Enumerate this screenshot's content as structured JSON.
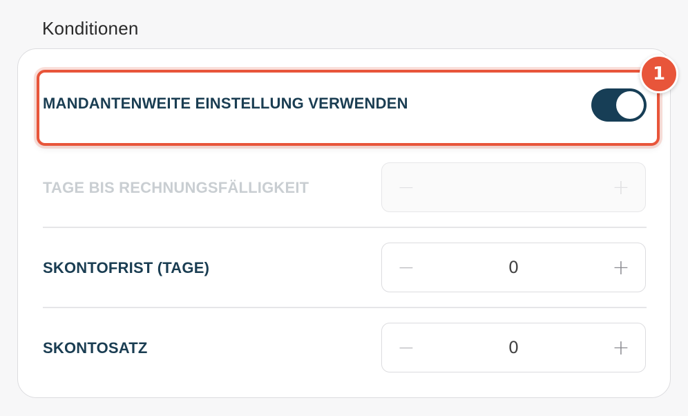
{
  "section": {
    "title": "Konditionen"
  },
  "badge": {
    "number": "1",
    "color": "#e8553a"
  },
  "toggle_row": {
    "label": "MANDANTENWEITE EINSTELLUNG VERWENDEN",
    "checked": true,
    "color": "#173e56"
  },
  "rows": [
    {
      "label": "TAGE BIS RECHNUNGSFÄLLIGKEIT",
      "value": "",
      "disabled": true,
      "minus_icon": "minus-icon",
      "plus_icon": "plus-icon"
    },
    {
      "label": "SKONTOFRIST (TAGE)",
      "value": "0",
      "disabled": false,
      "minus_icon": "minus-icon",
      "plus_icon": "plus-icon"
    },
    {
      "label": "SKONTOSATZ",
      "value": "0",
      "disabled": false,
      "minus_icon": "minus-icon",
      "plus_icon": "plus-icon"
    }
  ],
  "stepper_glyphs": {
    "minus": "−",
    "plus": "+"
  },
  "colors": {
    "label": "#1a3d52",
    "label_disabled": "#c9ced2",
    "highlight": "#e8553a"
  }
}
